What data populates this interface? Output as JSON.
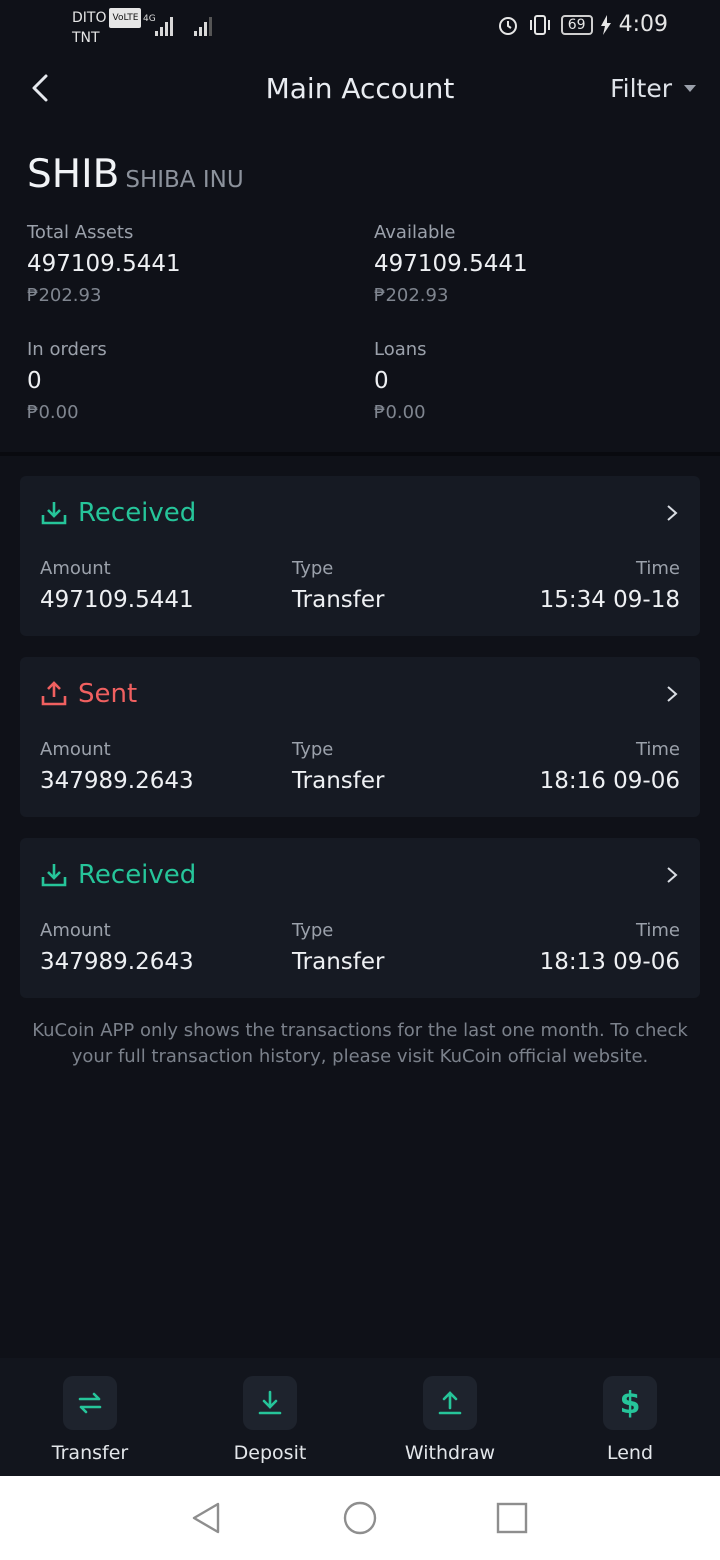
{
  "status_bar": {
    "carrier_1": "DITO",
    "carrier_1_badge": "VoLTE",
    "carrier_2": "TNT",
    "network": "4G",
    "battery": "69",
    "time": "4:09"
  },
  "header": {
    "title": "Main Account",
    "filter_label": "Filter"
  },
  "coin": {
    "symbol": "SHIB",
    "name": "SHIBA INU"
  },
  "balances": {
    "total_assets": {
      "label": "Total Assets",
      "value": "497109.5441",
      "fiat": "₱202.93"
    },
    "available": {
      "label": "Available",
      "value": "497109.5441",
      "fiat": "₱202.93"
    },
    "in_orders": {
      "label": "In orders",
      "value": "0",
      "fiat": "₱0.00"
    },
    "loans": {
      "label": "Loans",
      "value": "0",
      "fiat": "₱0.00"
    }
  },
  "transactions": [
    {
      "status": "Received",
      "amount_label": "Amount",
      "amount": "497109.5441",
      "type_label": "Type",
      "type": "Transfer",
      "time_label": "Time",
      "time": "15:34 09-18"
    },
    {
      "status": "Sent",
      "amount_label": "Amount",
      "amount": "347989.2643",
      "type_label": "Type",
      "type": "Transfer",
      "time_label": "Time",
      "time": "18:16 09-06"
    },
    {
      "status": "Received",
      "amount_label": "Amount",
      "amount": "347989.2643",
      "type_label": "Type",
      "type": "Transfer",
      "time_label": "Time",
      "time": "18:13 09-06"
    }
  ],
  "note": "KuCoin APP only shows the transactions for the last one month. To check your full transaction history, please visit KuCoin official website.",
  "actions": {
    "transfer": "Transfer",
    "deposit": "Deposit",
    "withdraw": "Withdraw",
    "lend": "Lend"
  },
  "colors": {
    "received": "#26c59a",
    "sent": "#f06060",
    "background": "#0f1118",
    "card": "#161a23"
  },
  "icons": {
    "back": "chevron-left-icon",
    "received": "download-tray-icon",
    "sent": "upload-tray-icon",
    "transfer": "swap-arrows-icon",
    "deposit": "download-icon",
    "withdraw": "upload-icon",
    "lend": "dollar-icon"
  }
}
